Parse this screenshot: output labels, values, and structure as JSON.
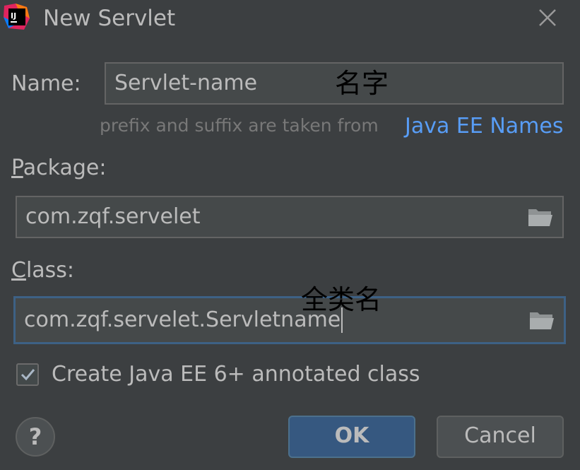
{
  "window": {
    "title": "New Servlet",
    "logo_text": "IJ",
    "logo_icon": "intellij-logo-icon",
    "close_icon": "close-icon"
  },
  "name": {
    "label": "Name:",
    "value": "Servlet-name",
    "hint": "prefix and suffix are taken from",
    "link": "Java EE Names",
    "annotation": "名字"
  },
  "package": {
    "label_mnemonic": "P",
    "label_rest": "ackage:",
    "value": "com.zqf.servelet",
    "folder_icon": "folder-icon"
  },
  "class": {
    "label_mnemonic": "C",
    "label_rest": "lass:",
    "value": "com.zqf.servelet.Servletname",
    "annotation": "全类名",
    "folder_icon": "folder-icon"
  },
  "annotated": {
    "checked": true,
    "label": "Create Java EE 6+ annotated class"
  },
  "buttons": {
    "help": "?",
    "ok": "OK",
    "cancel": "Cancel"
  },
  "colors": {
    "background": "#3c3f41",
    "link": "#589df6",
    "ok_button": "#365880",
    "focus_border": "#3d6185"
  }
}
